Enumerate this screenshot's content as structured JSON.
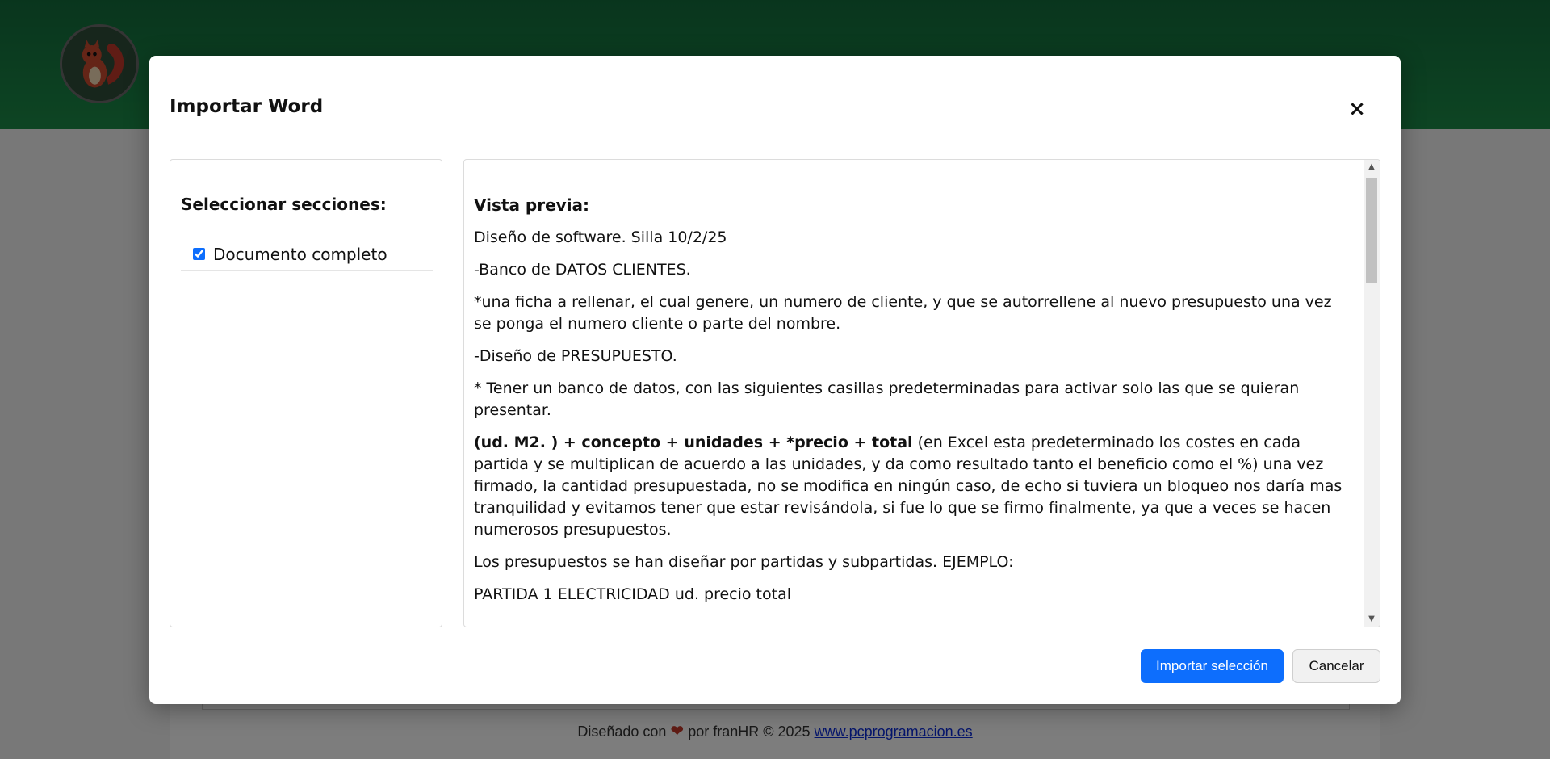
{
  "footer": {
    "prefix": "Diseñado con",
    "author": "por franHR",
    "copyright": "© 2025",
    "link": "www.pcprogramacion.es"
  },
  "modal": {
    "title": "Importar Word",
    "close": "×",
    "sections_title": "Seleccionar secciones:",
    "sections": [
      {
        "label": "Documento completo",
        "checked": true
      }
    ],
    "preview_title": "Vista previa:",
    "preview": {
      "p1": "Diseño de software. Silla 10/2/25",
      "p2": "-Banco de DATOS CLIENTES.",
      "p3": "*una ficha a rellenar, el cual genere, un numero de cliente, y que se autorrellene al nuevo presupuesto una vez se ponga el numero cliente o parte del nombre.",
      "p4": "-Diseño de PRESUPUESTO.",
      "p5": "* Tener un banco de datos, con las siguientes casillas predeterminadas para activar solo las que se quieran presentar.",
      "p6_bold": "(ud. M2. ) + concepto + unidades + *precio + total",
      "p6_rest": " (en Excel esta predeterminado los costes en cada partida y se multiplican de acuerdo a las unidades, y da como resultado tanto el beneficio como el %) una vez firmado, la cantidad presupuestada, no se modifica en ningún caso, de echo si tuviera un bloqueo nos daría mas tranquilidad y evitamos tener que estar revisándola, si fue lo que se firmo finalmente, ya que a veces se hacen numerosos presupuestos.",
      "p7": "Los presupuestos se han diseñar por partidas y subpartidas. EJEMPLO:",
      "p8": "PARTIDA 1 ELECTRICIDAD ud. precio total"
    },
    "import_button": "Importar selección",
    "cancel_button": "Cancelar"
  },
  "colors": {
    "header_green": "#1b8a47",
    "primary": "#0d6efd",
    "heart": "#c0392b"
  }
}
